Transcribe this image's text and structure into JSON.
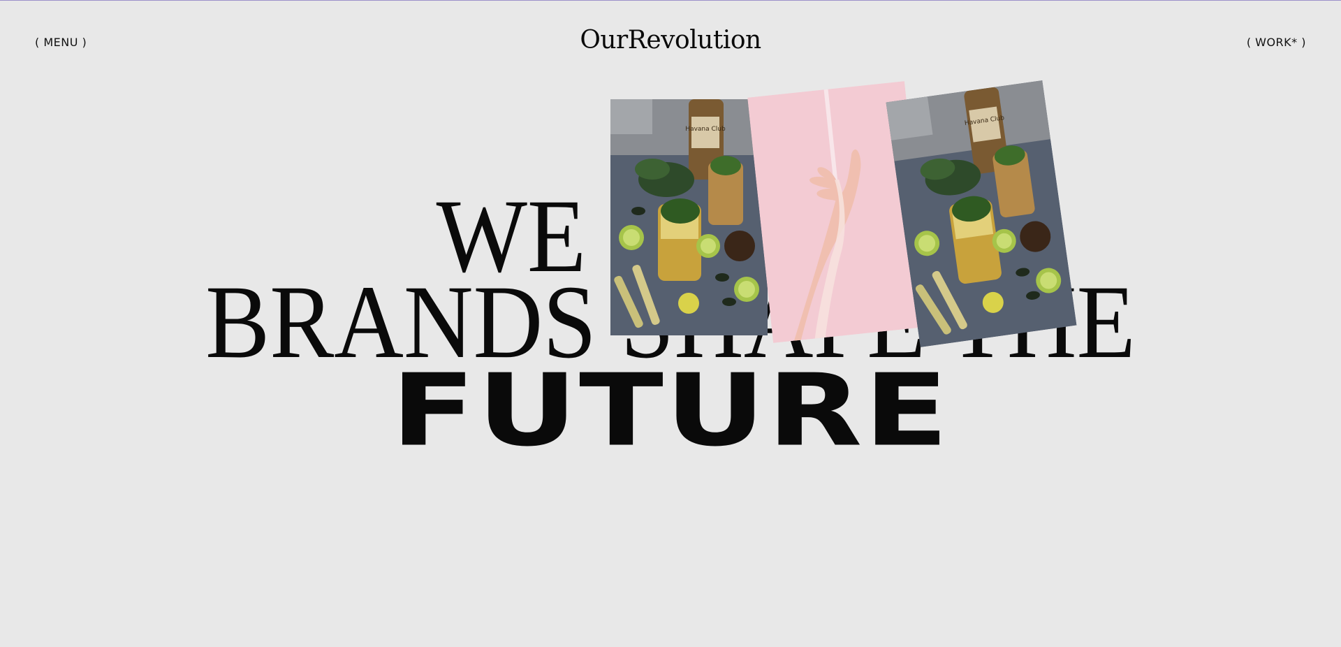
{
  "nav": {
    "menu_label": "( MENU )",
    "work_label": "( WORK* )"
  },
  "brand": {
    "logo_text": "OurRevolution"
  },
  "hero": {
    "line1": "WE BUILD",
    "line2": "BRANDS SHAPE THE",
    "line3": "FUTURE"
  },
  "gallery": {
    "photos": [
      {
        "subject": "mojito-cocktails-photo",
        "bottle_label": "Havana Club"
      },
      {
        "subject": "hand-pink-background-photo"
      },
      {
        "subject": "mojito-cocktails-photo",
        "bottle_label": "Havana Club"
      }
    ]
  },
  "colors": {
    "background": "#e8e8e8",
    "text": "#0a0a0a",
    "top_border": "#9b8fc9",
    "pink": "#f4c9d2"
  }
}
